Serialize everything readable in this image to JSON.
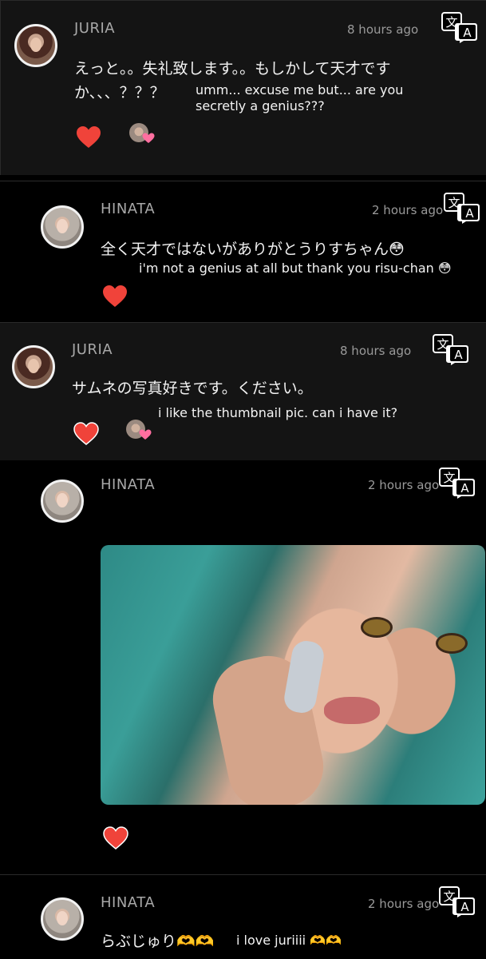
{
  "comments": [
    {
      "author": "JURIA",
      "time": "8 hours ago",
      "text_jp_1": "えっと。。失礼致します。。もしかして天才です",
      "text_jp_2": "か、、、？？？",
      "text_en_1": "umm... excuse me but... are you",
      "text_en_2": "secretly a genius???",
      "liked_by_author": true
    },
    {
      "author": "HINATA",
      "time": "2 hours ago",
      "text_jp": "全く天才ではないがありがとうりすちゃん😳",
      "text_en": "i'm not a genius at all but thank you risu-chan 😳"
    },
    {
      "author": "JURIA",
      "time": "8 hours ago",
      "text_jp": "サムネの写真好きです。ください。",
      "text_en": "i like the thumbnail pic. can i have it?",
      "liked_by_author": true
    },
    {
      "author": "HINATA",
      "time": "2 hours ago",
      "has_photo": true
    },
    {
      "author": "HINATA",
      "time": "2 hours ago",
      "text_jp": "らぶじゅり🫶🫶",
      "text_en": "i love juriiii 🫶🫶"
    }
  ],
  "icons": {
    "translate": "translate-icon",
    "heart": "heart-icon",
    "heart_color": "#f0433a",
    "mini_heart_color": "#ff6fa0"
  }
}
